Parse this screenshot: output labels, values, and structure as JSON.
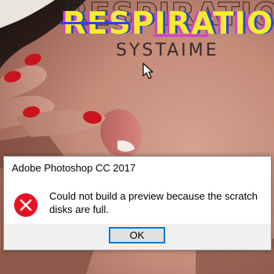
{
  "artwork": {
    "title": "RESPIRATION",
    "subtitle": "SYSTAIME"
  },
  "dialog": {
    "title": "Adobe Photoshop CC 2017",
    "message": "Could not build a preview because the scratch disks are full.",
    "ok_label": "OK",
    "icon": "error-icon"
  },
  "colors": {
    "title_fill": "#f3ee2a",
    "title_shadow_magenta": "#d63cd0",
    "title_shadow_blue": "#2845e6",
    "nail_polish": "#c8141e",
    "error_red": "#e81123",
    "button_border": "#0078d7"
  }
}
